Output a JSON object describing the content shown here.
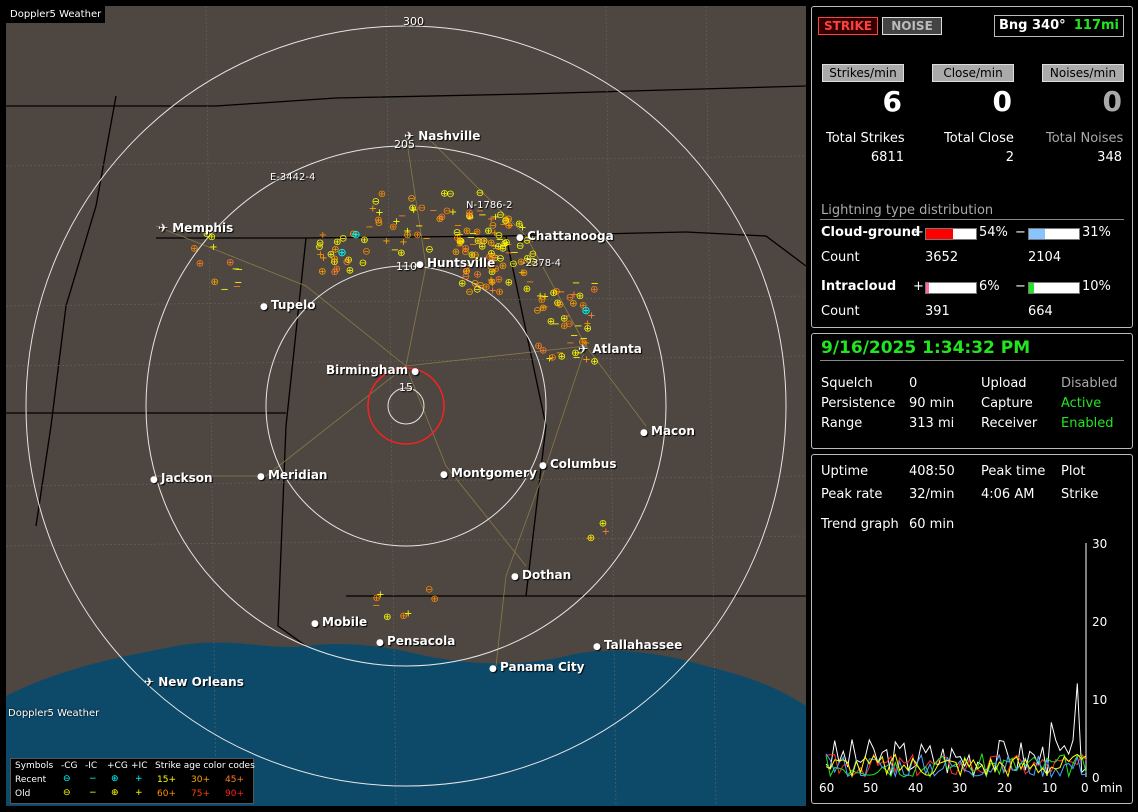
{
  "map": {
    "title": "Doppler5 Weather",
    "logo": "Doppler5 Weather",
    "range_labels": [
      "300",
      "205",
      "110",
      "15"
    ],
    "track_labels": [
      "E-3442-4",
      "N-1786-2",
      "-2378-4"
    ],
    "cities": [
      {
        "name": "Nashville",
        "icon": "airport-icon"
      },
      {
        "name": "Memphis",
        "icon": "airport-icon"
      },
      {
        "name": "Chattanooga",
        "icon": "city-dot-icon"
      },
      {
        "name": "Huntsville",
        "icon": "city-dot-icon"
      },
      {
        "name": "Tupelo",
        "icon": "city-dot-icon"
      },
      {
        "name": "Atlanta",
        "icon": "airport-icon"
      },
      {
        "name": "Birmingham",
        "icon": "city-dot-icon"
      },
      {
        "name": "Macon",
        "icon": "city-dot-icon"
      },
      {
        "name": "Jackson",
        "icon": "city-dot-icon"
      },
      {
        "name": "Meridian",
        "icon": "city-dot-icon"
      },
      {
        "name": "Montgomery",
        "icon": "city-dot-icon"
      },
      {
        "name": "Columbus",
        "icon": "city-dot-icon"
      },
      {
        "name": "Dothan",
        "icon": "city-dot-icon"
      },
      {
        "name": "Mobile",
        "icon": "city-dot-icon"
      },
      {
        "name": "Pensacola",
        "icon": "city-dot-icon"
      },
      {
        "name": "Tallahassee",
        "icon": "city-dot-icon"
      },
      {
        "name": "Panama City",
        "icon": "city-dot-icon"
      },
      {
        "name": "New Orleans",
        "icon": "airport-icon"
      }
    ],
    "legend": {
      "header": [
        "Symbols",
        "-CG",
        "-IC",
        "+CG",
        "+IC",
        "Strike age color codes"
      ],
      "recent": {
        "label": "Recent",
        "codes": [
          "15+",
          "30+",
          "45+"
        ]
      },
      "old": {
        "label": "Old",
        "codes": [
          "60+",
          "75+",
          "90+"
        ]
      },
      "colors": {
        "c15": "#ffff00",
        "c30": "#ffa500",
        "c45": "#ff7f27",
        "c60": "#ff8c00",
        "c75": "#ff4500",
        "c90": "#ff2020",
        "recent": "#00ffff",
        "old": "#ffff00"
      }
    }
  },
  "panel1": {
    "mode_strike": "STRIKE",
    "mode_noise": "NOISE",
    "bearing": "Bng 340°",
    "distance": "117mi",
    "strikes_min_label": "Strikes/min",
    "close_min_label": "Close/min",
    "noises_min_label": "Noises/min",
    "strikes_min": "6",
    "close_min": "0",
    "noises_min": "0",
    "total_strikes_label": "Total Strikes",
    "total_close_label": "Total Close",
    "total_noises_label": "Total Noises",
    "total_strikes": "6811",
    "total_close": "2",
    "total_noises": "348",
    "dist_title": "Lightning type distribution",
    "cg_label": "Cloud-ground",
    "ic_label": "Intracloud",
    "count_label": "Count",
    "plus": "+",
    "minus": "−",
    "cg_pos_pct": "54%",
    "cg_neg_pct": "31%",
    "cg_pos_count": "3652",
    "cg_neg_count": "2104",
    "ic_pos_pct": "6%",
    "ic_neg_pct": "10%",
    "ic_pos_count": "391",
    "ic_neg_count": "664",
    "cg_pos_frac": 0.54,
    "cg_neg_frac": 0.31,
    "ic_pos_frac": 0.06,
    "ic_neg_frac": 0.1
  },
  "panel2": {
    "datetime": "9/16/2025 1:34:32 PM",
    "squelch_label": "Squelch",
    "squelch": "0",
    "persistence_label": "Persistence",
    "persistence": "90 min",
    "range_label": "Range",
    "range": "313 mi",
    "upload_label": "Upload",
    "upload": "Disabled",
    "capture_label": "Capture",
    "capture": "Active",
    "receiver_label": "Receiver",
    "receiver": "Enabled"
  },
  "panel3": {
    "uptime_label": "Uptime",
    "uptime": "408:50",
    "peak_time_label": "Peak time",
    "peak_time": "4:06 AM",
    "plot_label": "Plot",
    "plot": "Strike",
    "peak_rate_label": "Peak rate",
    "peak_rate": "32/min",
    "trend_label": "Trend graph",
    "trend": "60 min",
    "y_ticks": [
      "30",
      "20",
      "10",
      "0"
    ],
    "x_ticks": [
      "60",
      "50",
      "40",
      "30",
      "20",
      "10",
      "0"
    ],
    "x_unit": "min"
  }
}
